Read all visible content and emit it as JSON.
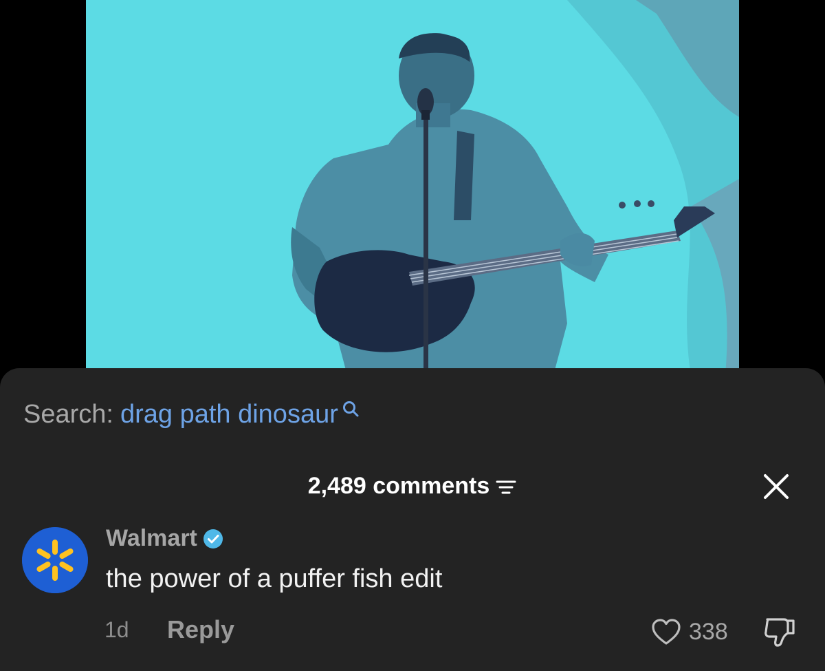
{
  "video": {
    "alt": "Performer playing bass guitar at a microphone on a blue-lit stage"
  },
  "search": {
    "prefix": "Search:",
    "query": "drag path dinosaur",
    "icon": "search-icon"
  },
  "comments": {
    "count_label": "2,489 comments",
    "sort_icon": "sort-icon",
    "close_icon": "close-icon"
  },
  "comment": {
    "author": "Walmart",
    "verified": true,
    "text": "the power of a puffer fish edit",
    "time": "1d",
    "reply_label": "Reply",
    "likes": "338"
  },
  "colors": {
    "sheet_bg": "#232323",
    "search_link": "#6ea3e6",
    "verified_badge": "#4fb8e8",
    "avatar_bg": "#1e5fd4",
    "avatar_spark": "#ffc220",
    "video_tint": "#5fdde6"
  }
}
